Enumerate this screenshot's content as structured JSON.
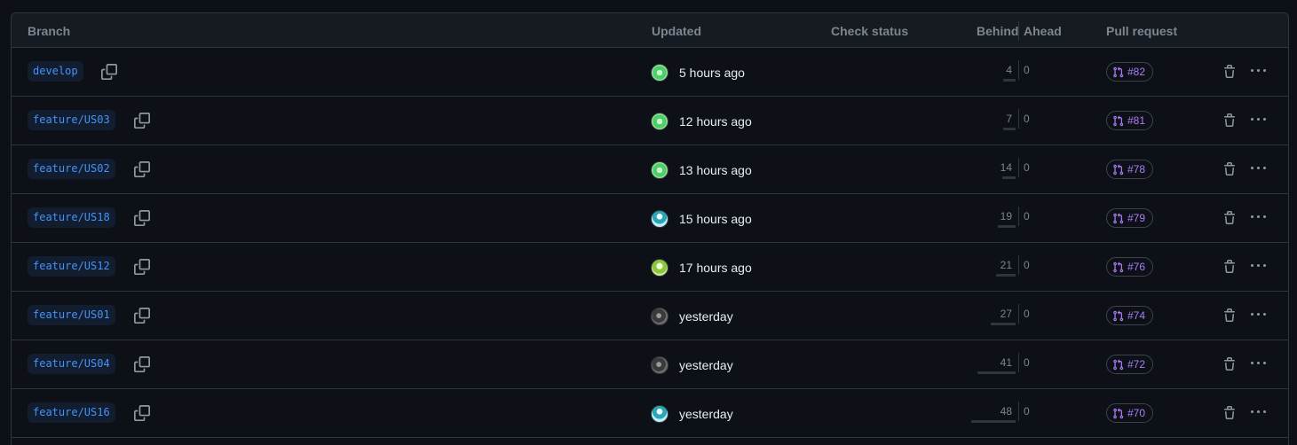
{
  "header": {
    "branch": "Branch",
    "updated": "Updated",
    "check_status": "Check status",
    "behind": "Behind",
    "ahead": "Ahead",
    "pull_request": "Pull request"
  },
  "colors": {
    "background": "#0d1117",
    "header_bg": "#161b22",
    "border": "#30363d",
    "branch_text": "#4493f8",
    "branch_bg": "#121d2f",
    "pr_text": "#ab7df8",
    "muted": "#7d8590"
  },
  "icons": {
    "copy": "copy-icon",
    "pull_request": "git-pull-request-icon",
    "delete": "trash-icon",
    "more": "kebab-horizontal-icon"
  },
  "rows": [
    {
      "branch": "develop",
      "updated": "5 hours ago",
      "behind": "4",
      "ahead": "0",
      "pr": "#82",
      "avatar": "green"
    },
    {
      "branch": "feature/US03",
      "updated": "12 hours ago",
      "behind": "7",
      "ahead": "0",
      "pr": "#81",
      "avatar": "green"
    },
    {
      "branch": "feature/US02",
      "updated": "13 hours ago",
      "behind": "14",
      "ahead": "0",
      "pr": "#78",
      "avatar": "green"
    },
    {
      "branch": "feature/US18",
      "updated": "15 hours ago",
      "behind": "19",
      "ahead": "0",
      "pr": "#79",
      "avatar": "teal"
    },
    {
      "branch": "feature/US12",
      "updated": "17 hours ago",
      "behind": "21",
      "ahead": "0",
      "pr": "#76",
      "avatar": "lime"
    },
    {
      "branch": "feature/US01",
      "updated": "yesterday",
      "behind": "27",
      "ahead": "0",
      "pr": "#74",
      "avatar": "gray"
    },
    {
      "branch": "feature/US04",
      "updated": "yesterday",
      "behind": "41",
      "ahead": "0",
      "pr": "#72",
      "avatar": "gray"
    },
    {
      "branch": "feature/US16",
      "updated": "yesterday",
      "behind": "48",
      "ahead": "0",
      "pr": "#70",
      "avatar": "teal"
    }
  ]
}
